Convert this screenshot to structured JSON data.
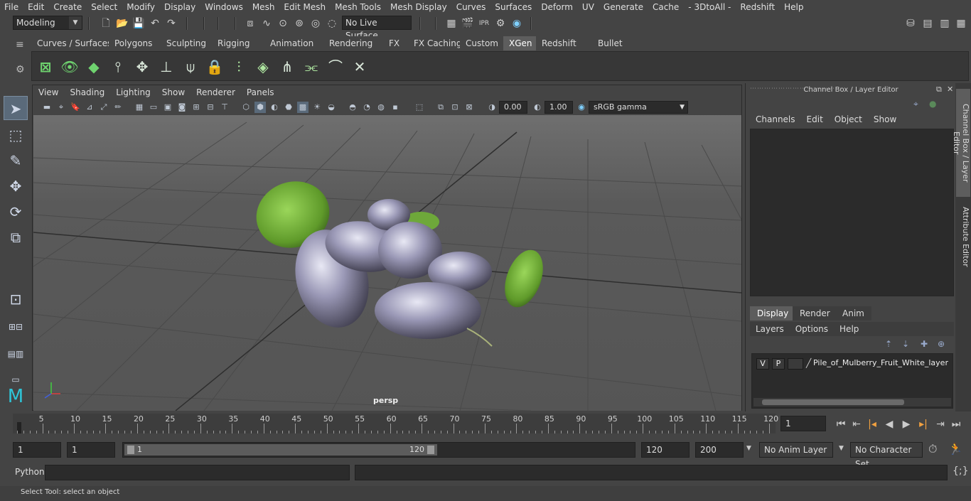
{
  "menus": [
    "File",
    "Edit",
    "Create",
    "Select",
    "Modify",
    "Display",
    "Windows",
    "Mesh",
    "Edit Mesh",
    "Mesh Tools",
    "Mesh Display",
    "Curves",
    "Surfaces",
    "Deform",
    "UV",
    "Generate",
    "Cache",
    "- 3DtoAll -",
    "Redshift",
    "Help"
  ],
  "status": {
    "mode": "Modeling",
    "live_surface": "No Live Surface"
  },
  "shelf": {
    "tabs": [
      "Curves / Surfaces",
      "Polygons",
      "Sculpting",
      "Rigging",
      "Animation",
      "Rendering",
      "FX",
      "FX Caching",
      "Custom",
      "XGen",
      "Redshift",
      "Bullet"
    ],
    "active": "XGen"
  },
  "viewport": {
    "menus": [
      "View",
      "Shading",
      "Lighting",
      "Show",
      "Renderer",
      "Panels"
    ],
    "exposure": "0.00",
    "gamma": "1.00",
    "color_space": "sRGB gamma",
    "camera": "persp"
  },
  "right_panel": {
    "title": "Channel Box / Layer Editor",
    "menus": [
      "Channels",
      "Edit",
      "Object",
      "Show"
    ],
    "tabs": [
      "Display",
      "Render",
      "Anim"
    ],
    "active_tab": "Display",
    "layer_menus": [
      "Layers",
      "Options",
      "Help"
    ],
    "layer": {
      "v": "V",
      "p": "P",
      "name": "Pile_of_Mulberry_Fruit_White_layer"
    },
    "side_tabs": [
      "Channel Box / Layer Editor",
      "Attribute Editor"
    ]
  },
  "timeline": {
    "ticks": [
      "5",
      "10",
      "15",
      "20",
      "25",
      "30",
      "35",
      "40",
      "45",
      "50",
      "55",
      "60",
      "65",
      "70",
      "75",
      "80",
      "85",
      "90",
      "95",
      "100",
      "105",
      "110",
      "115",
      "120"
    ],
    "start_marker": "1",
    "current_frame": "1"
  },
  "range": {
    "start": "1",
    "playback_start": "1",
    "slider_start": "1",
    "slider_end": "120",
    "playback_end": "120",
    "end": "200",
    "anim_layer": "No Anim Layer",
    "character_set": "No Character Set"
  },
  "command": {
    "lang": "Python"
  },
  "help_text": "Select Tool: select an object"
}
